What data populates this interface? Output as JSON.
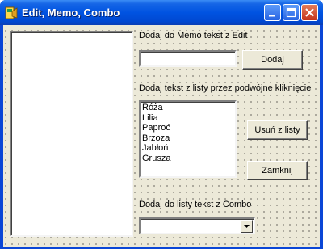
{
  "window": {
    "title": "Edit, Memo, Combo",
    "icons": [
      "app-icon",
      "minimize-icon",
      "maximize-icon",
      "close-icon"
    ]
  },
  "labels": {
    "memo_prompt": "Dodaj do Memo tekst z Edit",
    "listbox_prompt": "Dodaj tekst z listy przez podwójne kliknięcie",
    "combo_prompt": "Dodaj do listy tekst z Combo"
  },
  "edit": {
    "value": ""
  },
  "buttons": {
    "add": "Dodaj",
    "remove": "Usuń z listy",
    "close": "Zamknij"
  },
  "listbox": {
    "items": [
      "Róża",
      "Lilia",
      "Paproć",
      "Brzoza",
      "Jabłoń",
      "Grusza"
    ]
  },
  "combo": {
    "value": ""
  },
  "colors": {
    "titlebar": "#0053e1",
    "window_border": "#0a46d6",
    "client_bg": "#ece9d8",
    "close_button": "#c4331a"
  }
}
